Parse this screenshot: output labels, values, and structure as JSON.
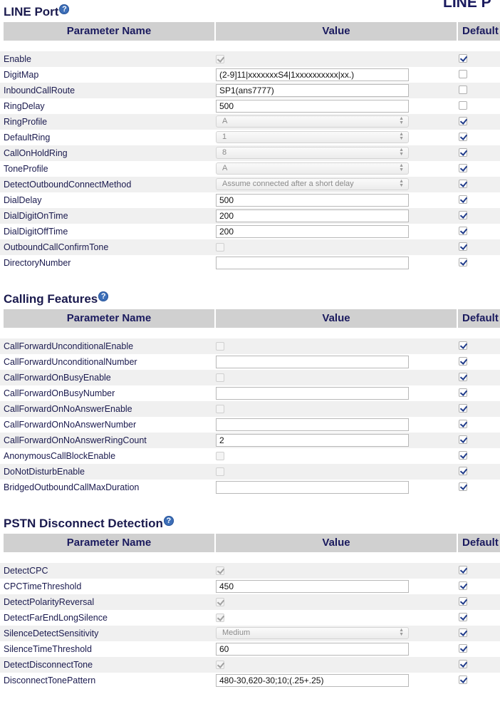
{
  "header_right": "LINE P",
  "columns": {
    "name": "Parameter Name",
    "value": "Value",
    "default": "Default"
  },
  "help_glyph": "?",
  "sections": [
    {
      "title": "LINE Port",
      "rows": [
        {
          "name": "Enable",
          "type": "checkbox",
          "checked": true,
          "disabled": true,
          "default": true
        },
        {
          "name": "DigitMap",
          "type": "text",
          "value": "(2-9]11|xxxxxxxS4|1xxxxxxxxxx|xx.)",
          "default": false
        },
        {
          "name": "InboundCallRoute",
          "type": "text",
          "value": "SP1(ans7777)",
          "default": false
        },
        {
          "name": "RingDelay",
          "type": "text",
          "value": "500",
          "default": false
        },
        {
          "name": "RingProfile",
          "type": "select",
          "value": "A",
          "default": true
        },
        {
          "name": "DefaultRing",
          "type": "select",
          "value": "1",
          "default": true
        },
        {
          "name": "CallOnHoldRing",
          "type": "select",
          "value": "8",
          "default": true
        },
        {
          "name": "ToneProfile",
          "type": "select",
          "value": "A",
          "default": true
        },
        {
          "name": "DetectOutboundConnectMethod",
          "type": "select",
          "value": "Assume connected after a short delay",
          "default": true
        },
        {
          "name": "DialDelay",
          "type": "text",
          "value": "500",
          "default": true
        },
        {
          "name": "DialDigitOnTime",
          "type": "text",
          "value": "200",
          "default": true
        },
        {
          "name": "DialDigitOffTime",
          "type": "text",
          "value": "200",
          "default": true
        },
        {
          "name": "OutboundCallConfirmTone",
          "type": "checkbox",
          "checked": false,
          "disabled": true,
          "default": true
        },
        {
          "name": "DirectoryNumber",
          "type": "text",
          "value": "",
          "default": true
        }
      ]
    },
    {
      "title": "Calling Features",
      "rows": [
        {
          "name": "CallForwardUnconditionalEnable",
          "type": "checkbox",
          "checked": false,
          "disabled": true,
          "default": true
        },
        {
          "name": "CallForwardUnconditionalNumber",
          "type": "text",
          "value": "",
          "default": true
        },
        {
          "name": "CallForwardOnBusyEnable",
          "type": "checkbox",
          "checked": false,
          "disabled": true,
          "default": true
        },
        {
          "name": "CallForwardOnBusyNumber",
          "type": "text",
          "value": "",
          "default": true
        },
        {
          "name": "CallForwardOnNoAnswerEnable",
          "type": "checkbox",
          "checked": false,
          "disabled": true,
          "default": true
        },
        {
          "name": "CallForwardOnNoAnswerNumber",
          "type": "text",
          "value": "",
          "default": true
        },
        {
          "name": "CallForwardOnNoAnswerRingCount",
          "type": "text",
          "value": "2",
          "default": true
        },
        {
          "name": "AnonymousCallBlockEnable",
          "type": "checkbox",
          "checked": false,
          "disabled": true,
          "default": true
        },
        {
          "name": "DoNotDisturbEnable",
          "type": "checkbox",
          "checked": false,
          "disabled": true,
          "default": true
        },
        {
          "name": "BridgedOutboundCallMaxDuration",
          "type": "text",
          "value": "",
          "default": true
        }
      ]
    },
    {
      "title": "PSTN Disconnect Detection",
      "rows": [
        {
          "name": "DetectCPC",
          "type": "checkbox",
          "checked": true,
          "disabled": true,
          "default": true
        },
        {
          "name": "CPCTimeThreshold",
          "type": "text",
          "value": "450",
          "default": true
        },
        {
          "name": "DetectPolarityReversal",
          "type": "checkbox",
          "checked": true,
          "disabled": true,
          "default": true
        },
        {
          "name": "DetectFarEndLongSilence",
          "type": "checkbox",
          "checked": true,
          "disabled": true,
          "default": true
        },
        {
          "name": "SilenceDetectSensitivity",
          "type": "select",
          "value": "Medium",
          "default": true
        },
        {
          "name": "SilenceTimeThreshold",
          "type": "text",
          "value": "60",
          "default": true
        },
        {
          "name": "DetectDisconnectTone",
          "type": "checkbox",
          "checked": true,
          "disabled": true,
          "default": true
        },
        {
          "name": "DisconnectTonePattern",
          "type": "text",
          "value": "480-30,620-30;10;(.25+.25)",
          "default": true
        }
      ]
    }
  ]
}
